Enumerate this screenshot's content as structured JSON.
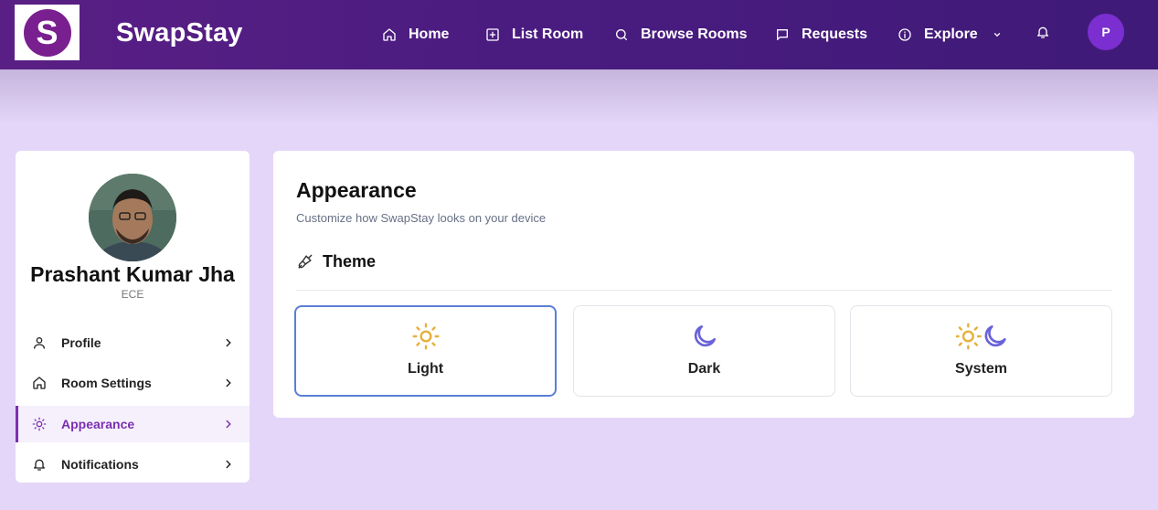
{
  "app": {
    "logo_letter": "S",
    "brand": "SwapStay",
    "colors": {
      "header": "#4a1c80",
      "accent": "#7b2fb0",
      "background": "#e4d6f9",
      "selected_border": "#5b7fd6"
    }
  },
  "nav": {
    "items": [
      {
        "label": "Home",
        "icon": "home-icon"
      },
      {
        "label": "List Room",
        "icon": "plus-square-icon"
      },
      {
        "label": "Browse Rooms",
        "icon": "search-icon"
      },
      {
        "label": "Requests",
        "icon": "message-icon"
      },
      {
        "label": "Explore",
        "icon": "info-icon"
      }
    ],
    "user_initial": "P"
  },
  "sidebar": {
    "name": "Prashant Kumar Jha",
    "department": "ECE",
    "menu": [
      {
        "label": "Profile",
        "icon": "user-icon"
      },
      {
        "label": "Room Settings",
        "icon": "home-icon"
      },
      {
        "label": "Appearance",
        "icon": "sun-icon",
        "active": true
      },
      {
        "label": "Notifications",
        "icon": "bell-icon"
      }
    ]
  },
  "appearance": {
    "title": "Appearance",
    "subtitle": "Customize how SwapStay looks on your device",
    "section": "Theme",
    "options": [
      {
        "label": "Light",
        "icon": "sun-icon",
        "selected": true
      },
      {
        "label": "Dark",
        "icon": "moon-icon"
      },
      {
        "label": "System",
        "icon": "sun-moon-icon"
      }
    ]
  }
}
